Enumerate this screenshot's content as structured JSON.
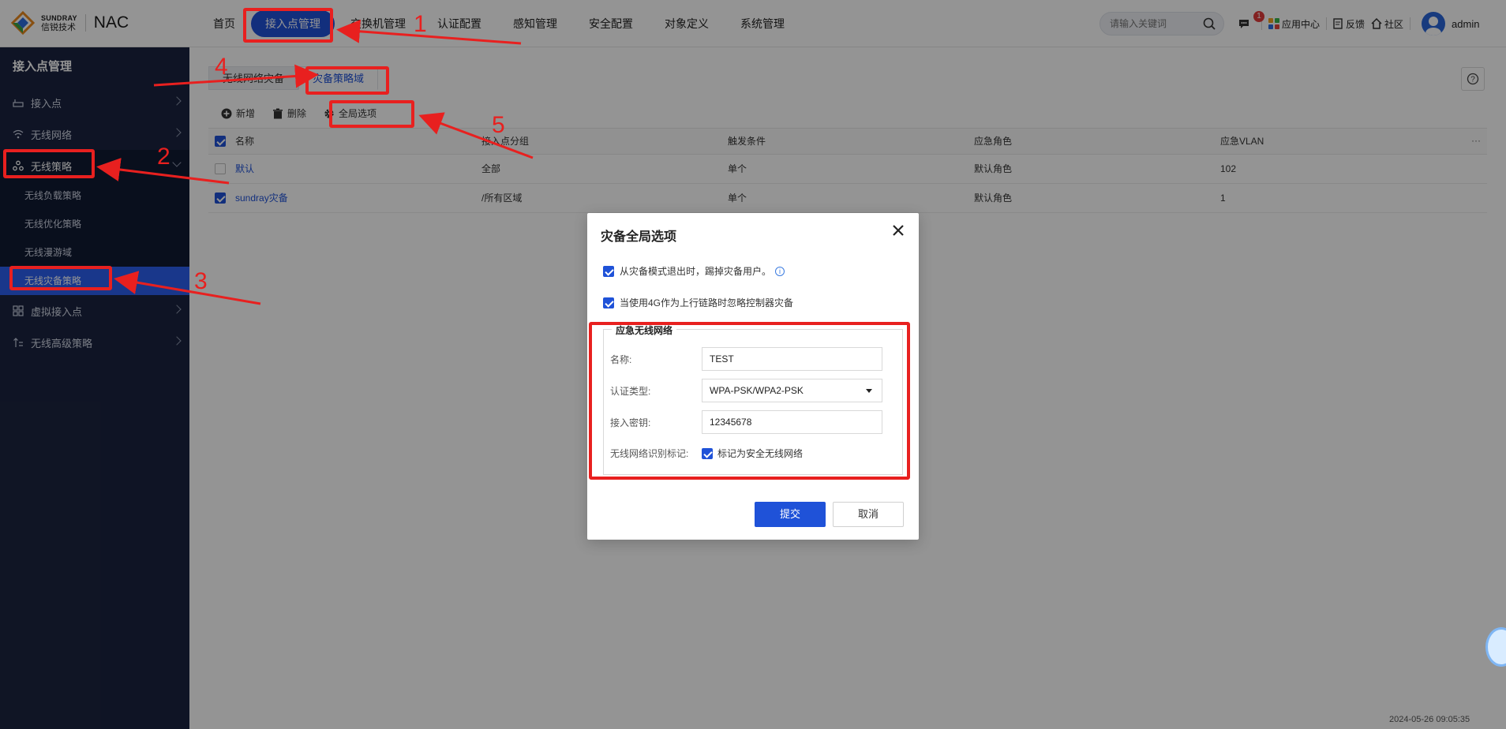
{
  "brand": {
    "en": "SUNDRAY",
    "cn": "信锐技术",
    "product": "NAC"
  },
  "topnav": [
    {
      "label": "首页"
    },
    {
      "label": "接入点管理",
      "active": true
    },
    {
      "label": "交换机管理"
    },
    {
      "label": "认证配置"
    },
    {
      "label": "感知管理"
    },
    {
      "label": "安全配置"
    },
    {
      "label": "对象定义"
    },
    {
      "label": "系统管理"
    }
  ],
  "search": {
    "placeholder": "请输入关键词"
  },
  "header_tools": {
    "message_count": "1",
    "app_center": "应用中心",
    "feedback": "反馈",
    "community": "社区",
    "user": "admin"
  },
  "sidebar": {
    "title": "接入点管理",
    "items": [
      {
        "label": "接入点",
        "icon": "router-icon"
      },
      {
        "label": "无线网络",
        "icon": "wifi-icon"
      },
      {
        "label": "无线策略",
        "icon": "policy-icon",
        "open": true
      },
      {
        "label": "虚拟接入点",
        "icon": "grid-icon"
      },
      {
        "label": "无线高级策略",
        "icon": "advanced-icon"
      }
    ],
    "subitems": [
      {
        "label": "无线负载策略"
      },
      {
        "label": "无线优化策略"
      },
      {
        "label": "无线漫游域"
      },
      {
        "label": "无线灾备策略",
        "active": true
      }
    ]
  },
  "tabs": [
    {
      "label": "无线网络灾备"
    },
    {
      "label": "灾备策略域",
      "active": true
    }
  ],
  "toolbar": {
    "add": "新增",
    "delete": "删除",
    "global": "全局选项"
  },
  "table": {
    "columns": [
      "名称",
      "接入点分组",
      "触发条件",
      "应急角色",
      "应急VLAN"
    ],
    "more": "···",
    "rows": [
      {
        "name": "默认",
        "group": "全部",
        "trigger": "单个",
        "role": "默认角色",
        "vlan": "102",
        "checked": false
      },
      {
        "name": "sundray灾备",
        "group": "/所有区域",
        "trigger": "单个",
        "role": "默认角色",
        "vlan": "1",
        "checked": true
      }
    ]
  },
  "modal": {
    "title": "灾备全局选项",
    "opt1": "从灾备模式退出时，踢掉灾备用户。",
    "opt2": "当使用4G作为上行链路时忽略控制器灾备",
    "section": "应急无线网络",
    "name_label": "名称:",
    "name_value": "TEST",
    "auth_label": "认证类型:",
    "auth_value": "WPA-PSK/WPA2-PSK",
    "key_label": "接入密钥:",
    "key_value": "12345678",
    "mark_label": "无线网络识别标记:",
    "mark_value": "标记为安全无线网络",
    "submit": "提交",
    "cancel": "取消"
  },
  "footer": {
    "time": "2024-05-26 09:05:35"
  },
  "annotations": {
    "n1": "1",
    "n2": "2",
    "n3": "3",
    "n4": "4",
    "n5": "5"
  },
  "colors": {
    "accent": "#1f52d8",
    "sidebar_bg": "#1b2440",
    "annotation": "#e8201f"
  }
}
